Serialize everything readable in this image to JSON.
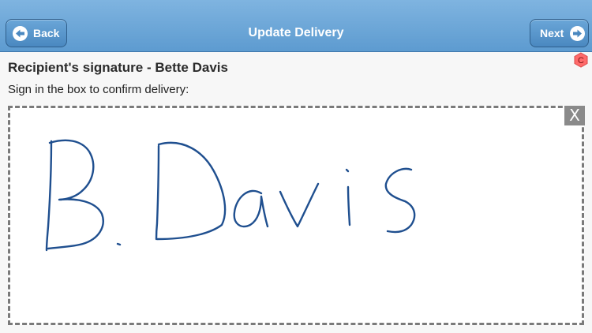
{
  "header": {
    "title": "Update Delivery",
    "back_label": "Back",
    "next_label": "Next"
  },
  "recipient": {
    "title": "Recipient's signature - Bette Davis"
  },
  "instructions": "Sign in the box to confirm delivery:",
  "badge": {
    "letter": "C",
    "color": "#ff6b6b"
  },
  "signature_pad": {
    "clear_label": "X",
    "stroke_color": "#1f4f8f"
  },
  "colors": {
    "nav_bar": "#6aa6d8",
    "button_border": "#2f5f8c"
  },
  "icons": {
    "back": "arrow-left-icon",
    "next": "arrow-right-icon"
  }
}
